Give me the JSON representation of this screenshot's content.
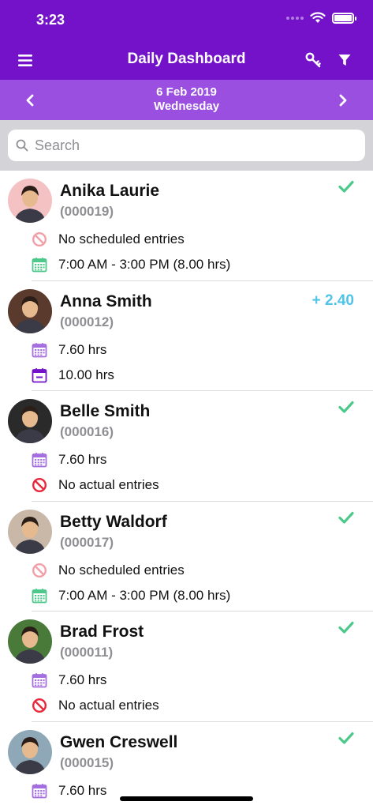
{
  "status_bar": {
    "time": "3:23"
  },
  "nav": {
    "title": "Daily Dashboard"
  },
  "date_bar": {
    "date": "6 Feb 2019",
    "weekday": "Wednesday"
  },
  "search": {
    "placeholder": "Search"
  },
  "colors": {
    "header_purple": "#7412c9",
    "date_bar_purple": "#9a4fe0",
    "check_green": "#4cc98a",
    "extra_blue": "#4fc3e8",
    "calendar_purple": "#a56ee0",
    "calendar_green": "#4cc98a",
    "no_entry_red": "#e8273b",
    "no_entry_pink": "#f2a0a8"
  },
  "employees": [
    {
      "name": "Anika Laurie",
      "id": "(000019)",
      "status_icon": "check-icon",
      "status_text": "",
      "avatar_color": "#f4c2c2",
      "entries": [
        {
          "icon": "no-entry-light-icon",
          "text": "No scheduled entries"
        },
        {
          "icon": "calendar-green-icon",
          "text": "7:00 AM - 3:00 PM (8.00 hrs)"
        }
      ]
    },
    {
      "name": "Anna Smith",
      "id": "(000012)",
      "status_icon": "",
      "status_text": "+ 2.40",
      "avatar_color": "#5a3a2c",
      "entries": [
        {
          "icon": "calendar-purple-icon",
          "text": "7.60 hrs"
        },
        {
          "icon": "calendar-dark-purple-icon",
          "text": "10.00 hrs"
        }
      ]
    },
    {
      "name": "Belle Smith",
      "id": "(000016)",
      "status_icon": "check-icon",
      "status_text": "",
      "avatar_color": "#2a2a2a",
      "entries": [
        {
          "icon": "calendar-purple-icon",
          "text": "7.60 hrs"
        },
        {
          "icon": "no-entry-red-icon",
          "text": "No actual entries"
        }
      ]
    },
    {
      "name": "Betty Waldorf",
      "id": "(000017)",
      "status_icon": "check-icon",
      "status_text": "",
      "avatar_color": "#c9b8a8",
      "entries": [
        {
          "icon": "no-entry-light-icon",
          "text": "No scheduled entries"
        },
        {
          "icon": "calendar-green-icon",
          "text": "7:00 AM - 3:00 PM (8.00 hrs)"
        }
      ]
    },
    {
      "name": "Brad Frost",
      "id": "(000011)",
      "status_icon": "check-icon",
      "status_text": "",
      "avatar_color": "#4a7a3a",
      "entries": [
        {
          "icon": "calendar-purple-icon",
          "text": "7.60 hrs"
        },
        {
          "icon": "no-entry-red-icon",
          "text": "No actual entries"
        }
      ]
    },
    {
      "name": "Gwen Creswell",
      "id": "(000015)",
      "status_icon": "check-icon",
      "status_text": "",
      "avatar_color": "#8fa8b8",
      "entries": [
        {
          "icon": "calendar-purple-icon",
          "text": "7.60 hrs"
        },
        {
          "icon": "no-entry-red-icon",
          "text": ""
        }
      ]
    }
  ]
}
